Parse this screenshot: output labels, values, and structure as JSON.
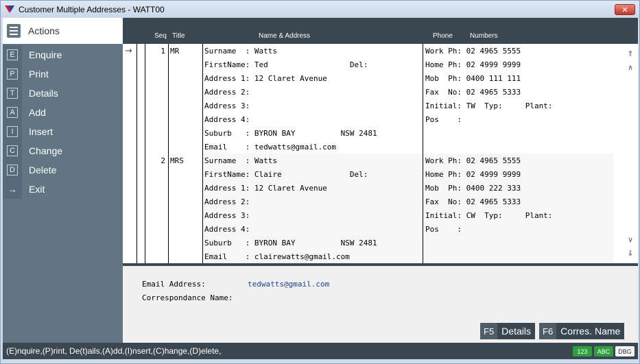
{
  "window": {
    "title": "Customer Multiple Addresses  - WATT00",
    "close_label": "✕"
  },
  "sidebar": {
    "actions_label": "Actions",
    "items": [
      {
        "key": "E",
        "label": "Enquire"
      },
      {
        "key": "P",
        "label": "Print"
      },
      {
        "key": "T",
        "label": "Details"
      },
      {
        "key": "A",
        "label": "Add"
      },
      {
        "key": "I",
        "label": "Insert"
      },
      {
        "key": "C",
        "label": "Change"
      },
      {
        "key": "D",
        "label": "Delete"
      },
      {
        "key": "→",
        "label": "Exit"
      }
    ]
  },
  "grid": {
    "headers": {
      "seq": "Seq",
      "title": "Title",
      "name_address": "Name & Address",
      "phone": "Phone",
      "numbers": "Numbers"
    },
    "rows": [
      {
        "seq": "1",
        "title": "MR",
        "address_lines": [
          "Surname  : Watts",
          "FirstName: Ted                  Del:",
          "Address 1: 12 Claret Avenue",
          "Address 2:",
          "Address 3:",
          "Address 4:",
          "Suburb   : BYRON BAY          NSW 2481",
          "Email    : tedwatts@gmail.com"
        ],
        "phone_lines": [
          "Work Ph: 02 4965 5555",
          "Home Ph: 02 4999 9999",
          "Mob  Ph: 0400 111 111",
          "Fax  No: 02 4965 5333",
          "Initial: TW  Typ:     Plant:",
          "Pos    :"
        ]
      },
      {
        "seq": "2",
        "title": "MRS",
        "address_lines": [
          "Surname  : Watts",
          "FirstName: Claire               Del:",
          "Address 1: 12 Claret Avenue",
          "Address 2:",
          "Address 3:",
          "Address 4:",
          "Suburb   : BYRON BAY          NSW 2481",
          "Email    : clairewatts@gmail.com"
        ],
        "phone_lines": [
          "Work Ph: 02 4965 5555",
          "Home Ph: 02 4999 9999",
          "Mob  Ph: 0400 222 333",
          "Fax  No: 02 4965 5333",
          "Initial: CW  Typ:     Plant:",
          "Pos    :"
        ]
      }
    ]
  },
  "detail": {
    "email_label": "Email Address:",
    "email_value": "tedwatts@gmail.com",
    "corr_label": "Correspondance Name:",
    "corr_value": ""
  },
  "fkeys": [
    {
      "key": "F5",
      "label": "Details"
    },
    {
      "key": "F6",
      "label": "Corres. Name"
    }
  ],
  "status": {
    "text": "(E)nquire,(P)rint, De(t)ails,(A)dd,(I)nsert,(C)hange,(D)elete,",
    "badges": [
      {
        "label": "123",
        "color": "#2e9e3e"
      },
      {
        "label": "ABC",
        "color": "#2e9e3e"
      },
      {
        "label": "DBG",
        "color": "#f4f4f4"
      }
    ]
  },
  "colors": {
    "sidebar": "#617582",
    "header": "#3a4650",
    "accent_link": "#1f3f8f"
  }
}
